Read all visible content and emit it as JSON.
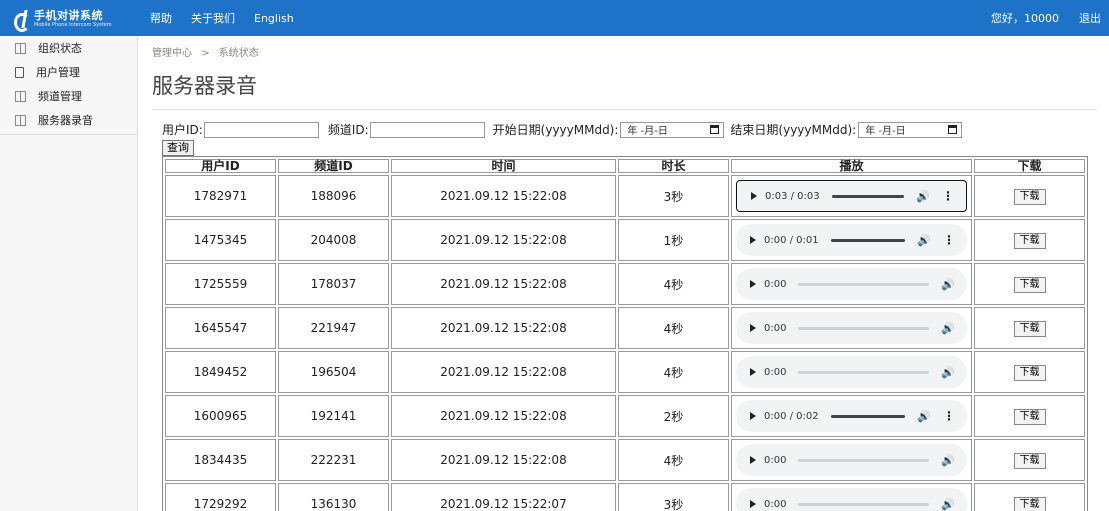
{
  "app": {
    "logo_title": "手机对讲系统",
    "logo_sub": "Mobile Phone Intercom System"
  },
  "nav": {
    "items": [
      "帮助",
      "关于我们",
      "English"
    ],
    "greeting": "您好，10000",
    "logout": "退出"
  },
  "sidebar": {
    "items": [
      {
        "label": "组织状态",
        "icon": "book-icon"
      },
      {
        "label": "用户管理",
        "icon": "file-icon"
      },
      {
        "label": "频道管理",
        "icon": "book-icon"
      },
      {
        "label": "服务器录音",
        "icon": "book-icon"
      }
    ]
  },
  "breadcrumb": [
    "管理中心",
    ">",
    "系统状态"
  ],
  "page_title": "服务器录音",
  "filters": {
    "user_id_label": "用户ID:",
    "user_id_value": "",
    "channel_id_label": "频道ID:",
    "channel_id_value": "",
    "start_label": "开始日期(yyyyMMdd):",
    "start_value": "年 -月-日",
    "end_label": "结束日期(yyyyMMdd):",
    "end_value": "年 -月-日",
    "query_label": "查询"
  },
  "table": {
    "headers": [
      "用户ID",
      "频道ID",
      "时间",
      "时长",
      "播放",
      "下载"
    ],
    "download_label": "下载",
    "rows": [
      {
        "user_id": "1782971",
        "channel_id": "188096",
        "time": "2021.09.12 15:22:08",
        "duration": "3秒",
        "player_time": "0:03 / 0:03",
        "full": true
      },
      {
        "user_id": "1475345",
        "channel_id": "204008",
        "time": "2021.09.12 15:22:08",
        "duration": "1秒",
        "player_time": "0:00 / 0:01",
        "full": true
      },
      {
        "user_id": "1725559",
        "channel_id": "178037",
        "time": "2021.09.12 15:22:08",
        "duration": "4秒",
        "player_time": "0:00",
        "full": false
      },
      {
        "user_id": "1645547",
        "channel_id": "221947",
        "time": "2021.09.12 15:22:08",
        "duration": "4秒",
        "player_time": "0:00",
        "full": false
      },
      {
        "user_id": "1849452",
        "channel_id": "196504",
        "time": "2021.09.12 15:22:08",
        "duration": "4秒",
        "player_time": "0:00",
        "full": false
      },
      {
        "user_id": "1600965",
        "channel_id": "192141",
        "time": "2021.09.12 15:22:08",
        "duration": "2秒",
        "player_time": "0:00 / 0:02",
        "full": true
      },
      {
        "user_id": "1834435",
        "channel_id": "222231",
        "time": "2021.09.12 15:22:08",
        "duration": "4秒",
        "player_time": "0:00",
        "full": false
      },
      {
        "user_id": "1729292",
        "channel_id": "136130",
        "time": "2021.09.12 15:22:07",
        "duration": "3秒",
        "player_time": "0:00",
        "full": false
      }
    ]
  }
}
